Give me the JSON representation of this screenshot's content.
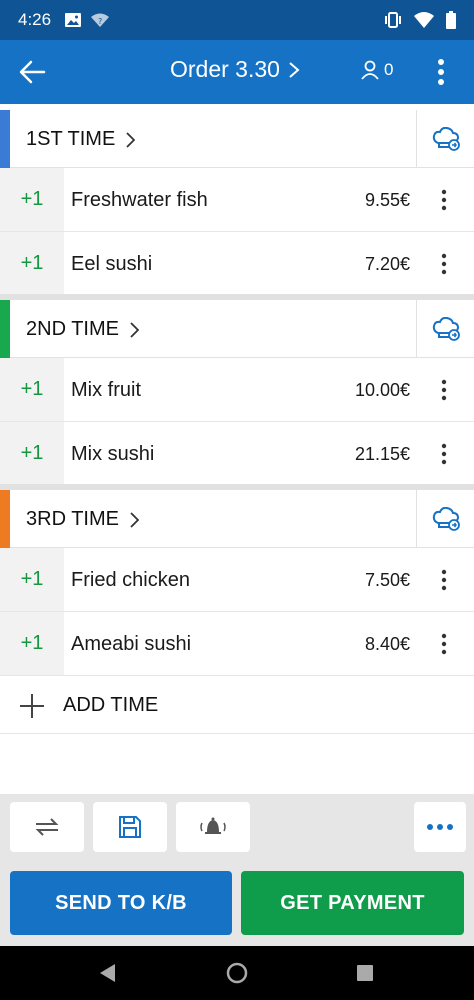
{
  "status_bar": {
    "time": "4:26"
  },
  "app_bar": {
    "title": "Order 3.30",
    "guest_count": "0"
  },
  "sections": [
    {
      "label": "1ST TIME",
      "color": "#3a7bd5",
      "items": [
        {
          "qty": "+1",
          "name": "Freshwater fish",
          "price": "9.55€"
        },
        {
          "qty": "+1",
          "name": "Eel sushi",
          "price": "7.20€"
        }
      ]
    },
    {
      "label": "2ND TIME",
      "color": "#18a84d",
      "items": [
        {
          "qty": "+1",
          "name": "Mix fruit",
          "price": "10.00€"
        },
        {
          "qty": "+1",
          "name": "Mix sushi",
          "price": "21.15€"
        }
      ]
    },
    {
      "label": "3RD TIME",
      "color": "#ee7a22",
      "items": [
        {
          "qty": "+1",
          "name": "Fried chicken",
          "price": "7.50€"
        },
        {
          "qty": "+1",
          "name": "Ameabi sushi",
          "price": "8.40€"
        }
      ]
    }
  ],
  "add_time_label": "ADD TIME",
  "buttons": {
    "send": "SEND TO K/B",
    "pay": "GET PAYMENT"
  },
  "icons": {
    "back": "arrow-left-icon",
    "guests": "person-icon",
    "menu": "kebab-icon",
    "chef": "chef-hat-icon",
    "transfer": "swap-icon",
    "save": "floppy-disk-icon",
    "notify": "bell-icon",
    "more": "ellipsis-icon"
  },
  "colors": {
    "primary": "#1672c5",
    "status": "#0f5595",
    "success": "#0f9d4b",
    "qty_green": "#16963f"
  }
}
